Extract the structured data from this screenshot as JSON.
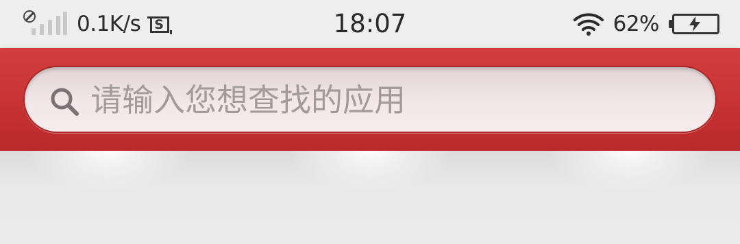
{
  "status_bar": {
    "network_speed": "0.1K/s",
    "time": "18:07",
    "battery_percent": "62%",
    "battery_level": 0.62,
    "charging": true,
    "icons": [
      "no-sim-signal-icon",
      "screenshot-icon",
      "wifi-icon",
      "battery-charging-icon"
    ]
  },
  "search": {
    "placeholder": "请输入您想查找的应用",
    "value": ""
  },
  "colors": {
    "header_red": "#c93334",
    "search_fill": "#f3e7e9",
    "placeholder_text": "#a39a9c",
    "status_bg": "#eeeeee"
  }
}
